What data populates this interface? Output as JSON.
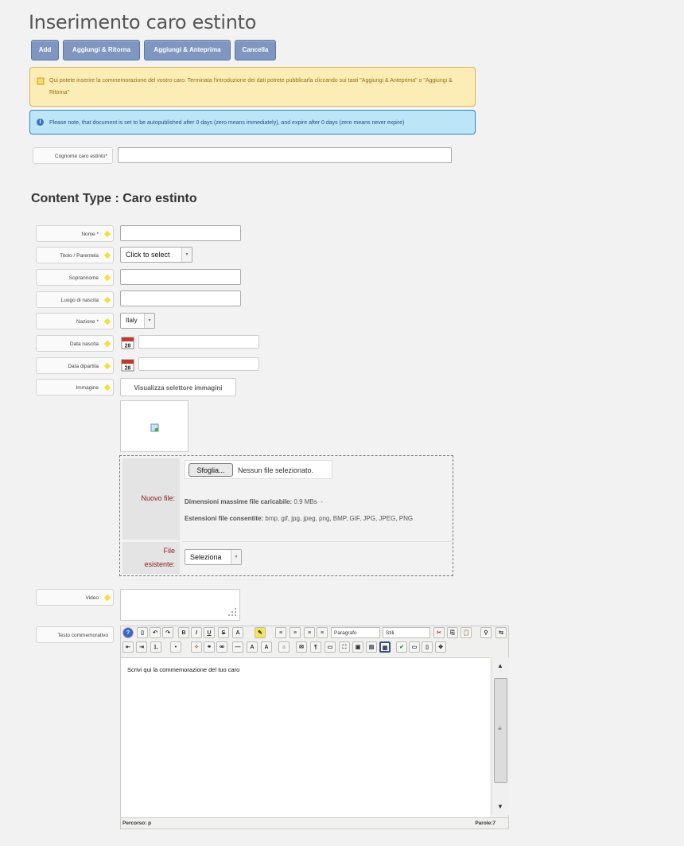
{
  "page": {
    "title": "Inserimento caro estinto"
  },
  "toolbar": {
    "add": "Add",
    "add_return": "Aggiungi & Ritorna",
    "add_preview": "Aggiungi & Anteprima",
    "cancel": "Cancella"
  },
  "messages": {
    "warning": "Qui potete inserire la commemorazione del vostro caro. Terminata l'introduzione dei dati potrete pubblicarla cliccando sui tasti \"Aggiungi & Anteprima\" o \"Aggiungi & Ritorna\"",
    "info": "Please note, that document is set to be autopublished after 0 days (zero means immediately), and expire after 0 days (zero means never expire)"
  },
  "surname_field": {
    "label": "Cognome caro estinto*",
    "value": ""
  },
  "content_type": {
    "heading": "Content Type : Caro estinto"
  },
  "fields": {
    "nome": {
      "label": "Nome *",
      "value": ""
    },
    "titolo": {
      "label": "Titolo / Parentela",
      "value": "Click to select"
    },
    "soprannome": {
      "label": "Soprannome",
      "value": ""
    },
    "luogo": {
      "label": "Luogo di nascita",
      "value": ""
    },
    "nazione": {
      "label": "Nazione *",
      "value": "Italy"
    },
    "data_nascita": {
      "label": "Data nascita",
      "value": ""
    },
    "data_dipartita": {
      "label": "Data dipartita",
      "value": ""
    },
    "immagine": {
      "label": "Immagine",
      "button": "Visualizza selettore immagini"
    },
    "video": {
      "label": "Video",
      "value": ""
    },
    "testo": {
      "label": "Testo commemorativo"
    }
  },
  "calendar": {
    "day": "28"
  },
  "upload": {
    "new_file_label": "Nuovo file:",
    "browse_button": "Sfoglia...",
    "no_file": "Nessun file selezionato.",
    "max_size_label": "Dimensioni massime file caricabile:",
    "max_size_value": "0.9 MBs",
    "max_size_sep": "-",
    "ext_label": "Estensioni file consentite:",
    "ext_value": "bmp, gif, jpg, jpeg, png, BMP, GIF, JPG, JPEG, PNG",
    "existing_label_1": "File",
    "existing_label_2": "esistente:",
    "existing_select": "Seleziona"
  },
  "editor": {
    "format_select": "Paragrafo",
    "style_select": "Stili",
    "body_text": "Scrivi qui la commemorazione del tuo caro",
    "path_label": "Percorso: p",
    "word_count": "Parole:7",
    "colors": {
      "accent": "#7f97c0",
      "warning_bg": "#fbedb5",
      "info_bg": "#bde5f8"
    }
  }
}
